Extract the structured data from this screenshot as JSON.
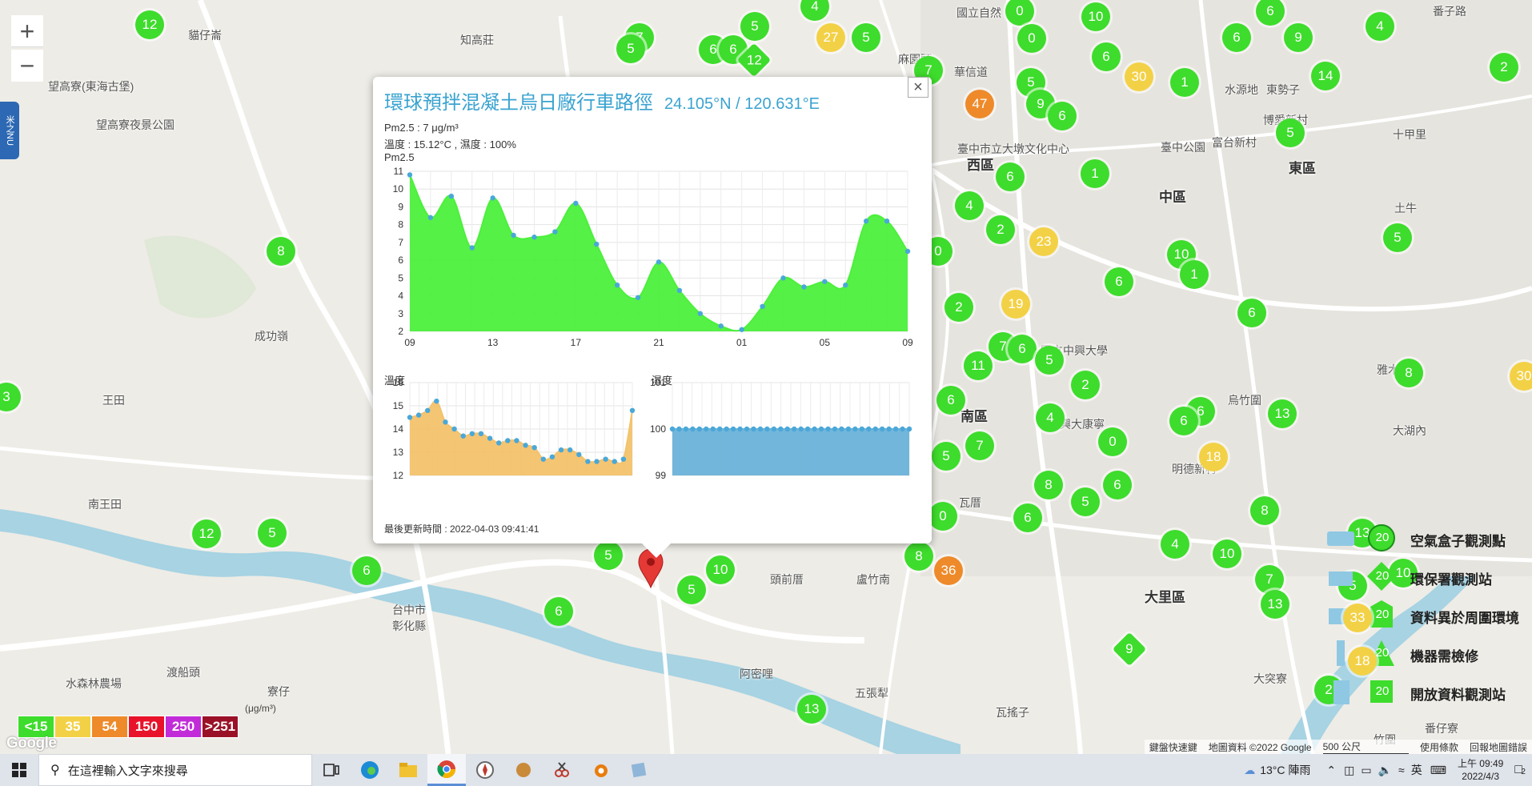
{
  "map": {
    "zoom_in": "+",
    "zoom_out": "−",
    "side_tab": "米之NU",
    "labels": [
      {
        "t": "貓仔崙",
        "x": 235,
        "y": 34,
        "big": false
      },
      {
        "t": "知高莊",
        "x": 575,
        "y": 40,
        "big": false
      },
      {
        "t": "國立自然",
        "x": 1195,
        "y": 6,
        "big": false
      },
      {
        "t": "番子路",
        "x": 1790,
        "y": 4,
        "big": false
      },
      {
        "t": "望高寮(東海古堡)",
        "x": 60,
        "y": 98,
        "big": false
      },
      {
        "t": "望高寮夜景公園",
        "x": 120,
        "y": 146,
        "big": false
      },
      {
        "t": "麻園頭",
        "x": 1122,
        "y": 64,
        "big": false
      },
      {
        "t": "華信道",
        "x": 1192,
        "y": 80,
        "big": false
      },
      {
        "t": "水源地",
        "x": 1530,
        "y": 102,
        "big": false
      },
      {
        "t": "東勢子",
        "x": 1582,
        "y": 102,
        "big": false
      },
      {
        "t": "博愛新村",
        "x": 1578,
        "y": 140,
        "big": false
      },
      {
        "t": "十甲里",
        "x": 1740,
        "y": 158,
        "big": false
      },
      {
        "t": "西區",
        "x": 1208,
        "y": 192,
        "big": true
      },
      {
        "t": "臺中市立大墩文化中心",
        "x": 1196,
        "y": 176,
        "big": false
      },
      {
        "t": "臺中公園",
        "x": 1450,
        "y": 174,
        "big": false
      },
      {
        "t": "富台新村",
        "x": 1514,
        "y": 168,
        "big": false
      },
      {
        "t": "東區",
        "x": 1610,
        "y": 196,
        "big": true
      },
      {
        "t": "中區",
        "x": 1448,
        "y": 232,
        "big": true
      },
      {
        "t": "土牛",
        "x": 1742,
        "y": 250,
        "big": false
      },
      {
        "t": "成功嶺",
        "x": 318,
        "y": 410,
        "big": false
      },
      {
        "t": "國立中興大學",
        "x": 1300,
        "y": 428,
        "big": false
      },
      {
        "t": "雅木耳",
        "x": 1720,
        "y": 452,
        "big": false
      },
      {
        "t": "王田",
        "x": 128,
        "y": 490,
        "big": false
      },
      {
        "t": "南區",
        "x": 1200,
        "y": 506,
        "big": true
      },
      {
        "t": "烏竹圍",
        "x": 1534,
        "y": 490,
        "big": false
      },
      {
        "t": "大湖內",
        "x": 1740,
        "y": 528,
        "big": false
      },
      {
        "t": "興大康寧",
        "x": 1324,
        "y": 520,
        "big": false
      },
      {
        "t": "傳泰商場",
        "x": 1140,
        "y": 560,
        "big": false
      },
      {
        "t": "明德新村",
        "x": 1464,
        "y": 576,
        "big": false
      },
      {
        "t": "南王田",
        "x": 110,
        "y": 620,
        "big": false
      },
      {
        "t": "瓦厝",
        "x": 1198,
        "y": 618,
        "big": false
      },
      {
        "t": "大里區",
        "x": 1430,
        "y": 732,
        "big": true
      },
      {
        "t": "台中市",
        "x": 490,
        "y": 752,
        "big": false
      },
      {
        "t": "彰化縣",
        "x": 490,
        "y": 772,
        "big": false
      },
      {
        "t": "頭前厝",
        "x": 962,
        "y": 714,
        "big": false
      },
      {
        "t": "盧竹南",
        "x": 1070,
        "y": 714,
        "big": false
      },
      {
        "t": "渡船頭",
        "x": 208,
        "y": 830,
        "big": false
      },
      {
        "t": "阿密哩",
        "x": 924,
        "y": 832,
        "big": false
      },
      {
        "t": "五張犁",
        "x": 1068,
        "y": 856,
        "big": false
      },
      {
        "t": "大突寮",
        "x": 1566,
        "y": 838,
        "big": false
      },
      {
        "t": "水森林農場",
        "x": 82,
        "y": 844,
        "big": false
      },
      {
        "t": "寮仔",
        "x": 334,
        "y": 854,
        "big": false
      },
      {
        "t": "瓦搖子",
        "x": 1244,
        "y": 880,
        "big": false
      },
      {
        "t": "番仔寮",
        "x": 1780,
        "y": 900,
        "big": false
      },
      {
        "t": "竹圍",
        "x": 1716,
        "y": 914,
        "big": false
      }
    ],
    "markers": [
      {
        "v": "12",
        "x": 187,
        "y": 31,
        "c": "#3edc2c",
        "s": "c"
      },
      {
        "v": "4",
        "x": 1018,
        "y": 8,
        "c": "#3edc2c",
        "s": "c"
      },
      {
        "v": "5",
        "x": 943,
        "y": 33,
        "c": "#3edc2c",
        "s": "c"
      },
      {
        "v": "27",
        "x": 1038,
        "y": 47,
        "c": "#f3d146",
        "s": "c"
      },
      {
        "v": "5",
        "x": 1082,
        "y": 47,
        "c": "#3edc2c",
        "s": "c"
      },
      {
        "v": "7",
        "x": 799,
        "y": 47,
        "c": "#3edc2c",
        "s": "c"
      },
      {
        "v": "5",
        "x": 788,
        "y": 61,
        "c": "#3edc2c",
        "s": "c"
      },
      {
        "v": "6",
        "x": 891,
        "y": 62,
        "c": "#3edc2c",
        "s": "c"
      },
      {
        "v": "6",
        "x": 916,
        "y": 62,
        "c": "#3edc2c",
        "s": "c"
      },
      {
        "v": "12",
        "x": 942,
        "y": 75,
        "c": "#3edc2c",
        "s": "d"
      },
      {
        "v": "0",
        "x": 1274,
        "y": 14,
        "c": "#3edc2c",
        "s": "c"
      },
      {
        "v": "10",
        "x": 1369,
        "y": 21,
        "c": "#3edc2c",
        "s": "c"
      },
      {
        "v": "6",
        "x": 1587,
        "y": 14,
        "c": "#3edc2c",
        "s": "c"
      },
      {
        "v": "0",
        "x": 1289,
        "y": 48,
        "c": "#3edc2c",
        "s": "c"
      },
      {
        "v": "6",
        "x": 1545,
        "y": 47,
        "c": "#3edc2c",
        "s": "c"
      },
      {
        "v": "9",
        "x": 1622,
        "y": 47,
        "c": "#3edc2c",
        "s": "c"
      },
      {
        "v": "4",
        "x": 1724,
        "y": 33,
        "c": "#3edc2c",
        "s": "c"
      },
      {
        "v": "6",
        "x": 1382,
        "y": 71,
        "c": "#3edc2c",
        "s": "c"
      },
      {
        "v": "30",
        "x": 1423,
        "y": 96,
        "c": "#f3d146",
        "s": "c"
      },
      {
        "v": "1",
        "x": 1480,
        "y": 103,
        "c": "#3edc2c",
        "s": "c"
      },
      {
        "v": "14",
        "x": 1656,
        "y": 95,
        "c": "#3edc2c",
        "s": "c"
      },
      {
        "v": "2",
        "x": 1879,
        "y": 84,
        "c": "#3edc2c",
        "s": "c"
      },
      {
        "v": "7",
        "x": 1160,
        "y": 88,
        "c": "#3edc2c",
        "s": "c"
      },
      {
        "v": "5",
        "x": 1288,
        "y": 103,
        "c": "#3edc2c",
        "s": "c"
      },
      {
        "v": "47",
        "x": 1224,
        "y": 130,
        "c": "#ee8a2a",
        "s": "c"
      },
      {
        "v": "9",
        "x": 1300,
        "y": 130,
        "c": "#3edc2c",
        "s": "c"
      },
      {
        "v": "6",
        "x": 1327,
        "y": 145,
        "c": "#3edc2c",
        "s": "c"
      },
      {
        "v": "5",
        "x": 1612,
        "y": 166,
        "c": "#3edc2c",
        "s": "c"
      },
      {
        "v": "6",
        "x": 1262,
        "y": 221,
        "c": "#3edc2c",
        "s": "c"
      },
      {
        "v": "1",
        "x": 1368,
        "y": 217,
        "c": "#3edc2c",
        "s": "c"
      },
      {
        "v": "4",
        "x": 1211,
        "y": 257,
        "c": "#3edc2c",
        "s": "c"
      },
      {
        "v": "2",
        "x": 1250,
        "y": 287,
        "c": "#3edc2c",
        "s": "c"
      },
      {
        "v": "23",
        "x": 1304,
        "y": 302,
        "c": "#f3d146",
        "s": "c"
      },
      {
        "v": "5",
        "x": 1746,
        "y": 297,
        "c": "#3edc2c",
        "s": "c"
      },
      {
        "v": "0",
        "x": 1172,
        "y": 314,
        "c": "#3edc2c",
        "s": "c"
      },
      {
        "v": "10",
        "x": 1476,
        "y": 318,
        "c": "#3edc2c",
        "s": "c"
      },
      {
        "v": "1",
        "x": 1492,
        "y": 343,
        "c": "#3edc2c",
        "s": "c"
      },
      {
        "v": "6",
        "x": 1398,
        "y": 352,
        "c": "#3edc2c",
        "s": "c"
      },
      {
        "v": "8",
        "x": 351,
        "y": 314,
        "c": "#3edc2c",
        "s": "c"
      },
      {
        "v": "2",
        "x": 1198,
        "y": 384,
        "c": "#3edc2c",
        "s": "c"
      },
      {
        "v": "19",
        "x": 1269,
        "y": 380,
        "c": "#f3d146",
        "s": "c"
      },
      {
        "v": "6",
        "x": 1564,
        "y": 391,
        "c": "#3edc2c",
        "s": "c"
      },
      {
        "v": "7",
        "x": 1253,
        "y": 433,
        "c": "#3edc2c",
        "s": "c"
      },
      {
        "v": "6",
        "x": 1277,
        "y": 436,
        "c": "#3edc2c",
        "s": "c"
      },
      {
        "v": "5",
        "x": 1311,
        "y": 450,
        "c": "#3edc2c",
        "s": "c"
      },
      {
        "v": "11",
        "x": 1222,
        "y": 457,
        "c": "#3edc2c",
        "s": "c"
      },
      {
        "v": "8",
        "x": 1760,
        "y": 466,
        "c": "#3edc2c",
        "s": "c"
      },
      {
        "v": "30",
        "x": 1904,
        "y": 470,
        "c": "#f3d146",
        "s": "c"
      },
      {
        "v": "2",
        "x": 1356,
        "y": 481,
        "c": "#3edc2c",
        "s": "c"
      },
      {
        "v": "3",
        "x": 8,
        "y": 496,
        "c": "#3edc2c",
        "s": "c"
      },
      {
        "v": "6",
        "x": 1188,
        "y": 500,
        "c": "#3edc2c",
        "s": "c"
      },
      {
        "v": "4",
        "x": 1312,
        "y": 522,
        "c": "#3edc2c",
        "s": "c"
      },
      {
        "v": "6",
        "x": 1500,
        "y": 514,
        "c": "#3edc2c",
        "s": "c"
      },
      {
        "v": "6",
        "x": 1479,
        "y": 526,
        "c": "#3edc2c",
        "s": "c"
      },
      {
        "v": "13",
        "x": 1602,
        "y": 517,
        "c": "#3edc2c",
        "s": "c"
      },
      {
        "v": "0",
        "x": 1390,
        "y": 552,
        "c": "#3edc2c",
        "s": "c"
      },
      {
        "v": "7",
        "x": 1224,
        "y": 557,
        "c": "#3edc2c",
        "s": "c"
      },
      {
        "v": "18",
        "x": 1516,
        "y": 571,
        "c": "#f3d146",
        "s": "c"
      },
      {
        "v": "5",
        "x": 1182,
        "y": 570,
        "c": "#3edc2c",
        "s": "c"
      },
      {
        "v": "8",
        "x": 1310,
        "y": 606,
        "c": "#3edc2c",
        "s": "c"
      },
      {
        "v": "6",
        "x": 1396,
        "y": 606,
        "c": "#3edc2c",
        "s": "c"
      },
      {
        "v": "5",
        "x": 1356,
        "y": 627,
        "c": "#3edc2c",
        "s": "c"
      },
      {
        "v": "8",
        "x": 1580,
        "y": 638,
        "c": "#3edc2c",
        "s": "c"
      },
      {
        "v": "0",
        "x": 1178,
        "y": 645,
        "c": "#3edc2c",
        "s": "c"
      },
      {
        "v": "6",
        "x": 1284,
        "y": 647,
        "c": "#3edc2c",
        "s": "c"
      },
      {
        "v": "12",
        "x": 258,
        "y": 667,
        "c": "#3edc2c",
        "s": "c"
      },
      {
        "v": "5",
        "x": 340,
        "y": 666,
        "c": "#3edc2c",
        "s": "c"
      },
      {
        "v": "13",
        "x": 1702,
        "y": 666,
        "c": "#3edc2c",
        "s": "c"
      },
      {
        "v": "4",
        "x": 1468,
        "y": 680,
        "c": "#3edc2c",
        "s": "c"
      },
      {
        "v": "10",
        "x": 1533,
        "y": 692,
        "c": "#3edc2c",
        "s": "c"
      },
      {
        "v": "5",
        "x": 760,
        "y": 694,
        "c": "#3edc2c",
        "s": "c"
      },
      {
        "v": "8",
        "x": 1148,
        "y": 695,
        "c": "#3edc2c",
        "s": "c"
      },
      {
        "v": "36",
        "x": 1185,
        "y": 713,
        "c": "#ee8a2a",
        "s": "c"
      },
      {
        "v": "10",
        "x": 900,
        "y": 712,
        "c": "#3edc2c",
        "s": "c"
      },
      {
        "v": "6",
        "x": 458,
        "y": 713,
        "c": "#3edc2c",
        "s": "c"
      },
      {
        "v": "7",
        "x": 1586,
        "y": 724,
        "c": "#3edc2c",
        "s": "c"
      },
      {
        "v": "10",
        "x": 1753,
        "y": 716,
        "c": "#3edc2c",
        "s": "c"
      },
      {
        "v": "5",
        "x": 1690,
        "y": 732,
        "c": "#3edc2c",
        "s": "c"
      },
      {
        "v": "5",
        "x": 864,
        "y": 737,
        "c": "#3edc2c",
        "s": "c"
      },
      {
        "v": "13",
        "x": 1593,
        "y": 755,
        "c": "#3edc2c",
        "s": "c"
      },
      {
        "v": "6",
        "x": 698,
        "y": 764,
        "c": "#3edc2c",
        "s": "c"
      },
      {
        "v": "9",
        "x": 1411,
        "y": 811,
        "c": "#3edc2c",
        "s": "d"
      },
      {
        "v": "2",
        "x": 1660,
        "y": 862,
        "c": "#3edc2c",
        "s": "c"
      },
      {
        "v": "13",
        "x": 1014,
        "y": 886,
        "c": "#3edc2c",
        "s": "c"
      }
    ]
  },
  "popup": {
    "close": "×",
    "title": "環球預拌混凝土烏日廠行車路徑",
    "coords": "24.105°N / 120.631°E",
    "pm25_line": "Pm2.5 : 7 μg/m³",
    "temp_hum_line": "溫度 : 15.12°C , 濕度 : 100%",
    "chart_title": "Pm2.5",
    "temp_title": "溫度",
    "hum_title": "濕度",
    "updated": "最後更新時間 : 2022-04-03 09:41:41"
  },
  "chart_data": [
    {
      "type": "area",
      "title": "Pm2.5",
      "color": "#4cf03c",
      "ylim": [
        2,
        11
      ],
      "yticks": [
        2,
        3,
        4,
        5,
        6,
        7,
        8,
        9,
        10,
        11
      ],
      "xticks": [
        "09",
        "13",
        "17",
        "21",
        "01",
        "05",
        "09"
      ],
      "values": [
        10.8,
        8.4,
        9.6,
        6.7,
        9.5,
        7.4,
        7.3,
        7.6,
        9.2,
        6.9,
        4.6,
        3.9,
        5.9,
        4.3,
        3.0,
        2.3,
        2.1,
        3.4,
        5.0,
        4.5,
        4.8,
        4.6,
        8.2,
        8.2,
        6.5
      ]
    },
    {
      "type": "area",
      "title": "溫度",
      "color": "#f3c26b",
      "ylim": [
        12,
        16
      ],
      "yticks": [
        12,
        13,
        14,
        15,
        16
      ],
      "values": [
        14.5,
        14.6,
        14.8,
        15.2,
        14.3,
        14.0,
        13.7,
        13.8,
        13.8,
        13.6,
        13.4,
        13.5,
        13.5,
        13.3,
        13.2,
        12.7,
        12.8,
        13.1,
        13.1,
        12.9,
        12.6,
        12.6,
        12.7,
        12.6,
        12.7,
        14.8
      ]
    },
    {
      "type": "area",
      "title": "濕度",
      "color": "#6cb2d9",
      "ylim": [
        99,
        101
      ],
      "yticks": [
        99,
        100,
        101
      ],
      "values": [
        100,
        100,
        100,
        100,
        100,
        100,
        100,
        100,
        100,
        100,
        100,
        100,
        100,
        100,
        100,
        100,
        100,
        100,
        100,
        100,
        100,
        100,
        100,
        100,
        100,
        100,
        100,
        100,
        100,
        100,
        100,
        100,
        100,
        100,
        100,
        100
      ]
    }
  ],
  "legend": {
    "items": [
      {
        "label": "空氣盒子觀測點",
        "value": "20"
      },
      {
        "label": "環保署觀測站",
        "value": "20"
      },
      {
        "label": "資料異於周圍環境",
        "value": "20"
      },
      {
        "label": "機器需檢修",
        "value": "20"
      },
      {
        "label": "開放資料觀測站",
        "value": "20"
      }
    ],
    "overlap_values": [
      "33",
      "18"
    ]
  },
  "aqi_scale": {
    "unit": "(μg/m³)",
    "items": [
      {
        "label": "<15",
        "color": "#3edc2c"
      },
      {
        "label": "35",
        "color": "#f3d146"
      },
      {
        "label": "54",
        "color": "#ee8a2a"
      },
      {
        "label": "150",
        "color": "#e8132a"
      },
      {
        "label": "250",
        "color": "#c12cd8"
      },
      {
        "label": ">251",
        "color": "#9a1127"
      }
    ]
  },
  "attribution": {
    "google": "Google",
    "shortcuts": "鍵盤快速鍵",
    "data": "地圖資料 ©2022 Google",
    "scale": "500 公尺",
    "terms": "使用條款",
    "report": "回報地圖錯誤"
  },
  "taskbar": {
    "search_placeholder": "在這裡輸入文字來搜尋",
    "weather": "13°C 陣雨",
    "ime": "英",
    "time": "上午 09:49",
    "date": "2022/4/3",
    "notif": "2"
  }
}
